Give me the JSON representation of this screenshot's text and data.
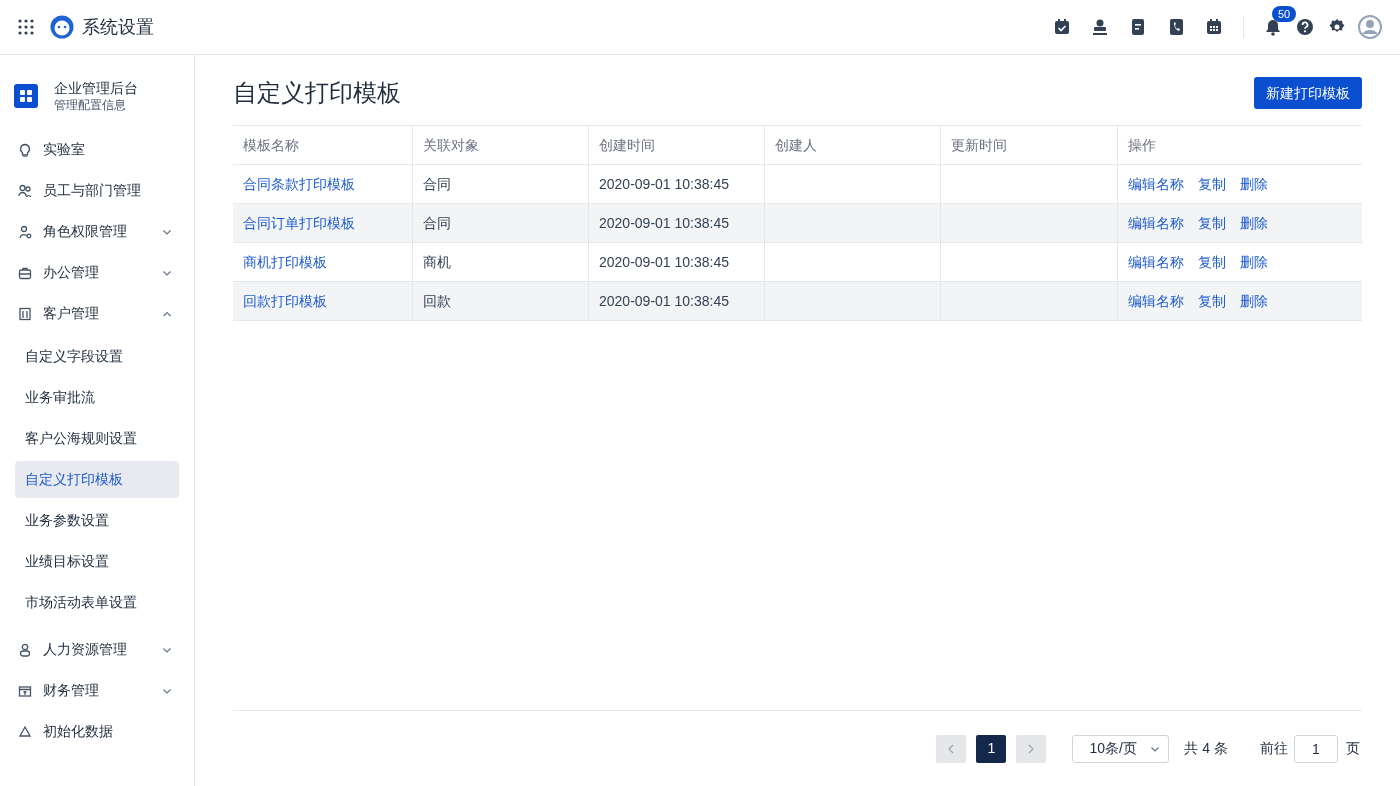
{
  "app_title": "系统设置",
  "header": {
    "badge": "50"
  },
  "sidebar": {
    "org": {
      "title": "企业管理后台",
      "subtitle": "管理配置信息"
    },
    "items": [
      {
        "label": "实验室"
      },
      {
        "label": "员工与部门管理"
      },
      {
        "label": "角色权限管理",
        "expanded": false
      },
      {
        "label": "办公管理",
        "expanded": false
      },
      {
        "label": "客户管理",
        "expanded": true,
        "children": [
          {
            "label": "自定义字段设置",
            "selected": false
          },
          {
            "label": "业务审批流",
            "selected": false
          },
          {
            "label": "客户公海规则设置",
            "selected": false
          },
          {
            "label": "自定义打印模板",
            "selected": true
          },
          {
            "label": "业务参数设置",
            "selected": false
          },
          {
            "label": "业绩目标设置",
            "selected": false
          },
          {
            "label": "市场活动表单设置",
            "selected": false
          }
        ]
      },
      {
        "label": "人力资源管理",
        "expanded": false
      },
      {
        "label": "财务管理",
        "expanded": false
      },
      {
        "label": "初始化数据"
      }
    ]
  },
  "page_title": "自定义打印模板",
  "new_button": "新建打印模板",
  "table": {
    "columns": [
      "模板名称",
      "关联对象",
      "创建时间",
      "创建人",
      "更新时间",
      "操作"
    ],
    "rows": [
      {
        "name": "合同条款打印模板",
        "object": "合同",
        "created": "2020-09-01 10:38:45",
        "actions": [
          "编辑名称",
          "复制",
          "删除"
        ]
      },
      {
        "name": "合同订单打印模板",
        "object": "合同",
        "created": "2020-09-01 10:38:45",
        "actions": [
          "编辑名称",
          "复制",
          "删除"
        ]
      },
      {
        "name": "商机打印模板",
        "object": "商机",
        "created": "2020-09-01 10:38:45",
        "actions": [
          "编辑名称",
          "复制",
          "删除"
        ]
      },
      {
        "name": "回款打印模板",
        "object": "回款",
        "created": "2020-09-01 10:38:45",
        "actions": [
          "编辑名称",
          "复制",
          "删除"
        ]
      }
    ]
  },
  "pagination": {
    "prev_disabled": true,
    "next_disabled": true,
    "pages": [
      {
        "label": "1",
        "selected": true
      }
    ],
    "page_size": "10条/页",
    "total": "共 4 条",
    "goto_label": "前往",
    "goto_value": "1",
    "goto_suffix": "页"
  }
}
